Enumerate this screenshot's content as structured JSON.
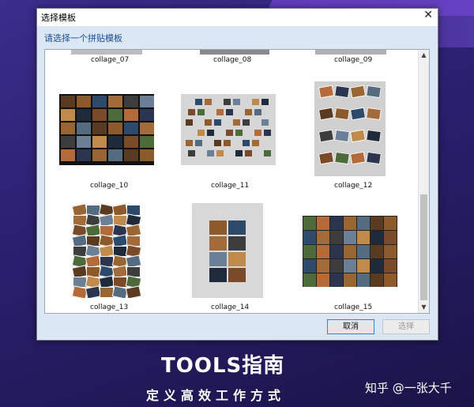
{
  "dialog": {
    "title": "选择模板",
    "close_glyph": "✕",
    "prompt": "请选择一个拼贴模板",
    "buttons": {
      "cancel": "取消",
      "select": "选择"
    }
  },
  "templates": [
    {
      "label": "collage_07"
    },
    {
      "label": "collage_08"
    },
    {
      "label": "collage_09"
    },
    {
      "label": "collage_10"
    },
    {
      "label": "collage_11"
    },
    {
      "label": "collage_12"
    },
    {
      "label": "collage_13"
    },
    {
      "label": "collage_14"
    },
    {
      "label": "collage_15"
    }
  ],
  "scrollbar": {
    "up_glyph": "▲",
    "down_glyph": "▼"
  },
  "banner": {
    "brand": "TOOLS指南",
    "slogan": "定义高效工作方式",
    "watermark": "知乎 @一张大千"
  },
  "colors": {
    "accent": "#1a4a9a",
    "client_bg": "#dbe7f5"
  }
}
